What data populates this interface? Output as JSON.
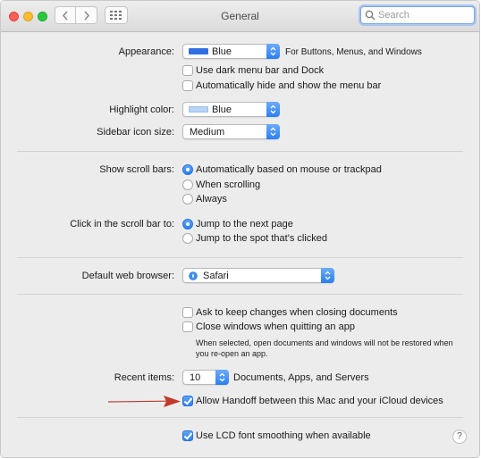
{
  "window": {
    "title": "General"
  },
  "search": {
    "placeholder": "Search"
  },
  "appearance": {
    "label": "Appearance:",
    "value": "Blue",
    "swatch_color": "#2f6fe0",
    "note": "For Buttons, Menus, and Windows",
    "dark_menu_label": "Use dark menu bar and Dock",
    "dark_menu_checked": false,
    "auto_hide_label": "Automatically hide and show the menu bar",
    "auto_hide_checked": false
  },
  "highlight": {
    "label": "Highlight color:",
    "value": "Blue",
    "swatch_color": "#b7d4f6"
  },
  "sidebar_icon": {
    "label": "Sidebar icon size:",
    "value": "Medium"
  },
  "scroll_bars": {
    "label": "Show scroll bars:",
    "options": [
      "Automatically based on mouse or trackpad",
      "When scrolling",
      "Always"
    ],
    "selected": 0
  },
  "click_scroll": {
    "label": "Click in the scroll bar to:",
    "options": [
      "Jump to the next page",
      "Jump to the spot that's clicked"
    ],
    "selected": 0
  },
  "browser": {
    "label": "Default web browser:",
    "value": "Safari"
  },
  "documents": {
    "ask_keep_label": "Ask to keep changes when closing documents",
    "ask_keep_checked": false,
    "close_windows_label": "Close windows when quitting an app",
    "close_windows_checked": false,
    "note": "When selected, open documents and windows will not be restored when you re-open an app."
  },
  "recent": {
    "label": "Recent items:",
    "value": "10",
    "suffix": "Documents, Apps, and Servers"
  },
  "handoff": {
    "label": "Allow Handoff between this Mac and your iCloud devices",
    "checked": true,
    "arrow_color": "#c0392b"
  },
  "lcd": {
    "label": "Use LCD font smoothing when available",
    "checked": true
  },
  "help": {
    "label": "?"
  }
}
